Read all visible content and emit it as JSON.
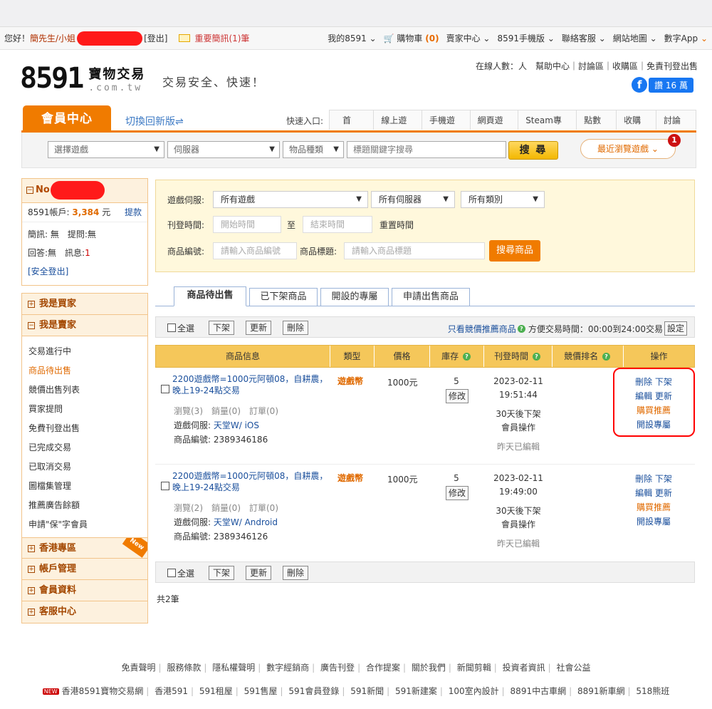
{
  "topbar": {
    "greeting": "您好！",
    "user_prefix": "簡先生/小姐",
    "logout": "[登出]",
    "mail": "重要簡訊(1)筆",
    "links": [
      "我的8591",
      "購物車",
      "賣家中心",
      "8591手機版",
      "聯絡客服",
      "網站地圖"
    ],
    "cart_count": "(0)",
    "app": "數字App"
  },
  "header": {
    "logo_num": "8591",
    "logo_cn": "寶物交易",
    "logo_com": ".com.tw",
    "slogan": "交易安全、快速！",
    "links_line": "在線人數：人　幫助中心｜討論區｜收購區｜免責刊登出售",
    "fb_like": "讚 16 萬"
  },
  "nav": {
    "member_tab": "會員中心",
    "switch": "切換回新版⇌",
    "quick_label": "快速入口:",
    "quick_links": [
      "首頁",
      "線上遊戲",
      "手機遊戲",
      "網頁遊戲",
      "Steam專區",
      "點數卡",
      "收購區",
      "討論區"
    ]
  },
  "searchbar": {
    "game_placeholder": "選擇遊戲",
    "server_placeholder": "伺服器",
    "type_placeholder": "物品種類",
    "keyword_placeholder": "標題關鍵字搜尋",
    "search_button": "搜 尋",
    "recent_button": "最近瀏覽遊戲",
    "recent_badge": "1"
  },
  "sidebar": {
    "user_prefix": "No",
    "account_label": "8591帳戶:",
    "account_value": "3,384",
    "account_unit": "元",
    "withdraw": "提款",
    "msg_line1": "簡訊: 無　提問:無",
    "msg_line2_a": "回答:無　訊息:",
    "msg_line2_b": "1",
    "logout": "[安全登出]",
    "buyer": "我是買家",
    "seller": "我是賣家",
    "seller_items": [
      "交易進行中",
      "商品待出售",
      "競價出售列表",
      "買家提問",
      "免費刊登出售",
      "已完成交易",
      "已取消交易",
      "圖檔集管理",
      "推薦廣告餘額",
      "申請\"保\"字會員"
    ],
    "hk": "香港專區",
    "hk_tag": "New",
    "account_mgmt": "帳戶管理",
    "member_info": "會員資料",
    "support": "客服中心"
  },
  "filter": {
    "server_label": "遊戲伺服:",
    "game_value": "所有遊戲",
    "server_value": "所有伺服器",
    "category_value": "所有類別",
    "date_label": "刊登時間:",
    "start_placeholder": "開始時間",
    "to": "至",
    "end_placeholder": "結束時間",
    "reset": "重置時間",
    "id_label": "商品編號:",
    "id_placeholder": "請輸入商品編號",
    "title_label": "商品標題:",
    "title_placeholder": "請輸入商品標題",
    "search_button": "搜尋商品"
  },
  "tabs": [
    "商品待出售",
    "已下架商品",
    "開設的專屬",
    "申請出售商品"
  ],
  "actions": {
    "select_all": "全選",
    "offline": "下架",
    "refresh": "更新",
    "delete": "刪除",
    "only_bid": "只看競價推薦商品",
    "convenient_time": "方便交易時間：00:00到24:00交易",
    "setting": "設定"
  },
  "table": {
    "headers": [
      "商品信息",
      "類型",
      "價格",
      "庫存",
      "刊登時間",
      "競價排名",
      "操作"
    ],
    "rows": [
      {
        "title": "2200遊戲幣=1000元阿頓08，自耕農，晚上19-24點交易",
        "stats": "瀏覽(3)　銷量(0)　訂單(0)",
        "server_label": "遊戲伺服:",
        "server": "天堂W/ iOS",
        "id": "商品編號: 2389346186",
        "type": "遊戲幣",
        "price": "1000元",
        "stock": "5",
        "modify": "修改",
        "date": "2023-02-11",
        "time": "19:51:44",
        "expire": "30天後下架",
        "member_op": "會員操作",
        "edited": "昨天已編輯",
        "ops_del": "刪除",
        "ops_off": "下架",
        "ops_edit": "編輯",
        "ops_refresh": "更新",
        "ops_buy": "購買推薦",
        "ops_open": "開設專屬"
      },
      {
        "title": "2200遊戲幣=1000元阿頓08，自耕農，晚上19-24點交易",
        "stats": "瀏覽(2)　銷量(0)　訂單(0)",
        "server_label": "遊戲伺服:",
        "server": "天堂W/ Android",
        "id": "商品編號: 2389346126",
        "type": "遊戲幣",
        "price": "1000元",
        "stock": "5",
        "modify": "修改",
        "date": "2023-02-11",
        "time": "19:49:00",
        "expire": "30天後下架",
        "member_op": "會員操作",
        "edited": "昨天已編輯",
        "ops_del": "刪除",
        "ops_off": "下架",
        "ops_edit": "編輯",
        "ops_refresh": "更新",
        "ops_buy": "購買推薦",
        "ops_open": "開設專屬"
      }
    ],
    "total": "共2筆"
  },
  "footer": {
    "row1": [
      "免責聲明",
      "服務條款",
      "隱私權聲明",
      "數字經銷商",
      "廣告刊登",
      "合作提案",
      "關於我們",
      "新聞剪輯",
      "投資者資訊",
      "社會公益"
    ],
    "row2_new": "NEW",
    "row2": [
      "香港8591寶物交易網",
      "香港591",
      "591租屋",
      "591售屋",
      "591會員登錄",
      "591新聞",
      "591新建案",
      "100室內設計",
      "8891中古車網",
      "8891新車網",
      "518熊班"
    ]
  }
}
